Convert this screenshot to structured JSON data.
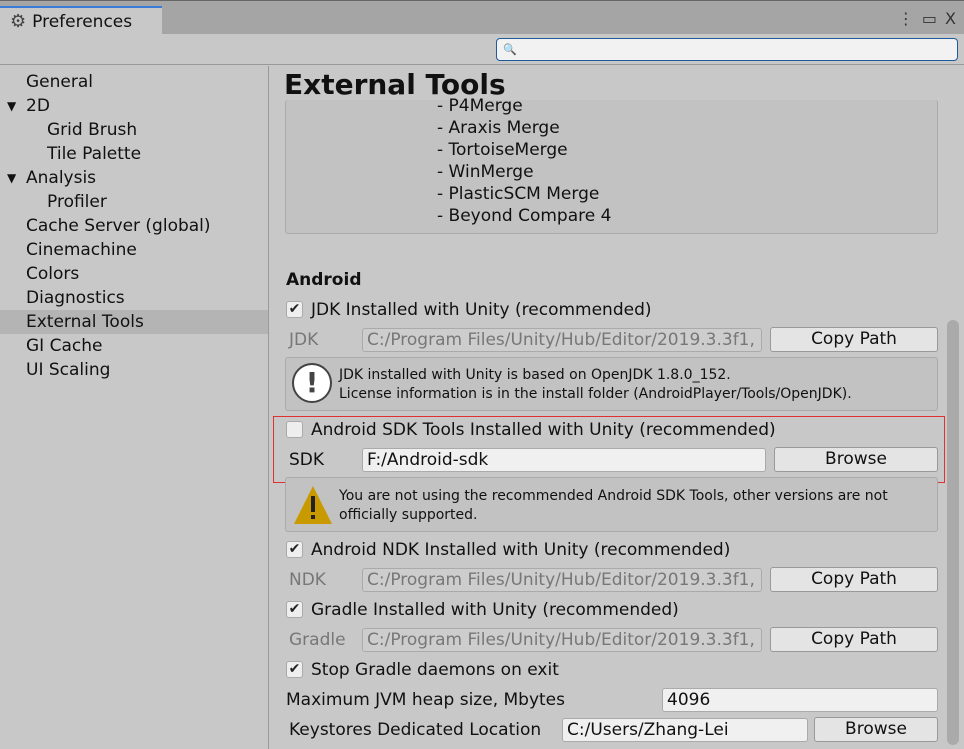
{
  "window": {
    "tab_title": "Preferences",
    "icons": [
      "gear-icon",
      "more-icon",
      "maximize-icon",
      "close-icon"
    ],
    "search_placeholder": ""
  },
  "sidebar": {
    "items": [
      {
        "label": "General",
        "indent": 0
      },
      {
        "label": "2D",
        "indent": 0,
        "expanded": true
      },
      {
        "label": "Grid Brush",
        "indent": 1
      },
      {
        "label": "Tile Palette",
        "indent": 1
      },
      {
        "label": "Analysis",
        "indent": 0,
        "expanded": true
      },
      {
        "label": "Profiler",
        "indent": 1
      },
      {
        "label": "Cache Server (global)",
        "indent": 0
      },
      {
        "label": "Cinemachine",
        "indent": 0
      },
      {
        "label": "Colors",
        "indent": 0
      },
      {
        "label": "Diagnostics",
        "indent": 0
      },
      {
        "label": "External Tools",
        "indent": 0,
        "selected": true
      },
      {
        "label": "GI Cache",
        "indent": 0
      },
      {
        "label": "UI Scaling",
        "indent": 0
      }
    ]
  },
  "main": {
    "title": "External Tools",
    "merge_tools": [
      "- P4Merge",
      "- Araxis Merge",
      "- TortoiseMerge",
      "- WinMerge",
      "- PlasticSCM Merge",
      "- Beyond Compare 4"
    ],
    "android_heading": "Android",
    "jdk": {
      "checkbox": "JDK Installed with Unity (recommended)",
      "checked": true,
      "label": "JDK",
      "path": "C:/Program Files/Unity/Hub/Editor/2019.3.3f1,",
      "button": "Copy Path",
      "info1": "JDK installed with Unity is based on OpenJDK 1.8.0_152.",
      "info2": "License information is in the install folder (AndroidPlayer/Tools/OpenJDK)."
    },
    "sdk": {
      "checkbox": "Android SDK Tools Installed with Unity (recommended)",
      "checked": false,
      "label": "SDK",
      "path": "F:/Android-sdk",
      "button": "Browse",
      "warning1": "You are not using the recommended Android SDK Tools, other versions are not",
      "warning2": "officially supported.",
      "highlight_color": "#e03030"
    },
    "ndk": {
      "checkbox": "Android NDK Installed with Unity (recommended)",
      "checked": true,
      "label": "NDK",
      "path": "C:/Program Files/Unity/Hub/Editor/2019.3.3f1,",
      "button": "Copy Path"
    },
    "gradle": {
      "checkbox": "Gradle Installed with Unity (recommended)",
      "checked": true,
      "label": "Gradle",
      "path": "C:/Program Files/Unity/Hub/Editor/2019.3.3f1,",
      "button": "Copy Path"
    },
    "stop_gradle": {
      "checkbox": "Stop Gradle daemons on exit",
      "checked": true
    },
    "jvm": {
      "label": "Maximum JVM heap size, Mbytes",
      "value": "4096"
    },
    "keystores": {
      "label": "Keystores Dedicated Location",
      "value": "C:/Users/Zhang-Lei",
      "button": "Browse"
    }
  }
}
